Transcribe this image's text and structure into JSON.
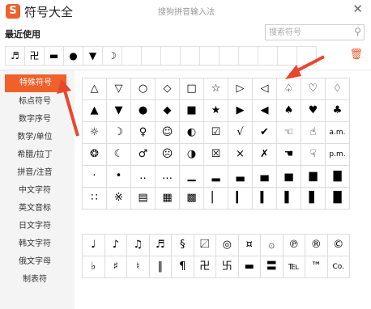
{
  "window": {
    "app_title": "符号大全",
    "caption": "搜狗拼音输入法",
    "logo_letter": "S",
    "close": "✕"
  },
  "recent": {
    "label": "最近使用",
    "symbols": [
      "♬",
      "卍",
      "▬",
      "●",
      "▼",
      "☽",
      "",
      "",
      "",
      "",
      "",
      "",
      "",
      "",
      "",
      "",
      ""
    ]
  },
  "search": {
    "placeholder": "搜索符号",
    "icon": "search-icon"
  },
  "trash_icon": "trash-icon",
  "sidebar": {
    "items": [
      {
        "label": "特殊符号",
        "active": true
      },
      {
        "label": "标点符号"
      },
      {
        "label": "数字序号"
      },
      {
        "label": "数学/单位"
      },
      {
        "label": "希腊/拉丁"
      },
      {
        "label": "拼音/注音"
      },
      {
        "label": "中文字符"
      },
      {
        "label": "英文音标"
      },
      {
        "label": "日文字符"
      },
      {
        "label": "韩文字符"
      },
      {
        "label": "俄文字母"
      },
      {
        "label": "制表符"
      }
    ]
  },
  "grid1": [
    [
      "△",
      "▽",
      "○",
      "◇",
      "□",
      "☆",
      "▷",
      "◁",
      "♤",
      "♡",
      "♢"
    ],
    [
      "▲",
      "▼",
      "●",
      "◆",
      "■",
      "★",
      "▶",
      "◀",
      "♠",
      "♥",
      "♣"
    ],
    [
      "☼",
      "☽",
      "♀",
      "☺",
      "◐",
      "☑",
      "√",
      "✔",
      "☜",
      "☝",
      "a.m."
    ],
    [
      "❂",
      "☾",
      "♂",
      "☹",
      "◑",
      "☒",
      "×",
      "✗",
      "☚",
      "☟",
      "p.m."
    ],
    [
      "·",
      "•",
      "‥",
      "…",
      "▁",
      "▂",
      "▃",
      "▄",
      "▅",
      "▆",
      "▇"
    ],
    [
      "∷",
      "※",
      "▤",
      "▦",
      "▩",
      "▏",
      "▎",
      "▍",
      "▌",
      "▋",
      "█"
    ]
  ],
  "grid2": [
    [
      "♩",
      "♪",
      "♫",
      "♬",
      "§",
      "〼",
      "◎",
      "¤",
      "۞",
      "℗",
      "®",
      "©"
    ],
    [
      "♭",
      "♯",
      "♮",
      "‖",
      "¶",
      "卍",
      "卐",
      "▬",
      "〓",
      "℡",
      "™",
      "Co."
    ]
  ],
  "accent": "#f0602a"
}
